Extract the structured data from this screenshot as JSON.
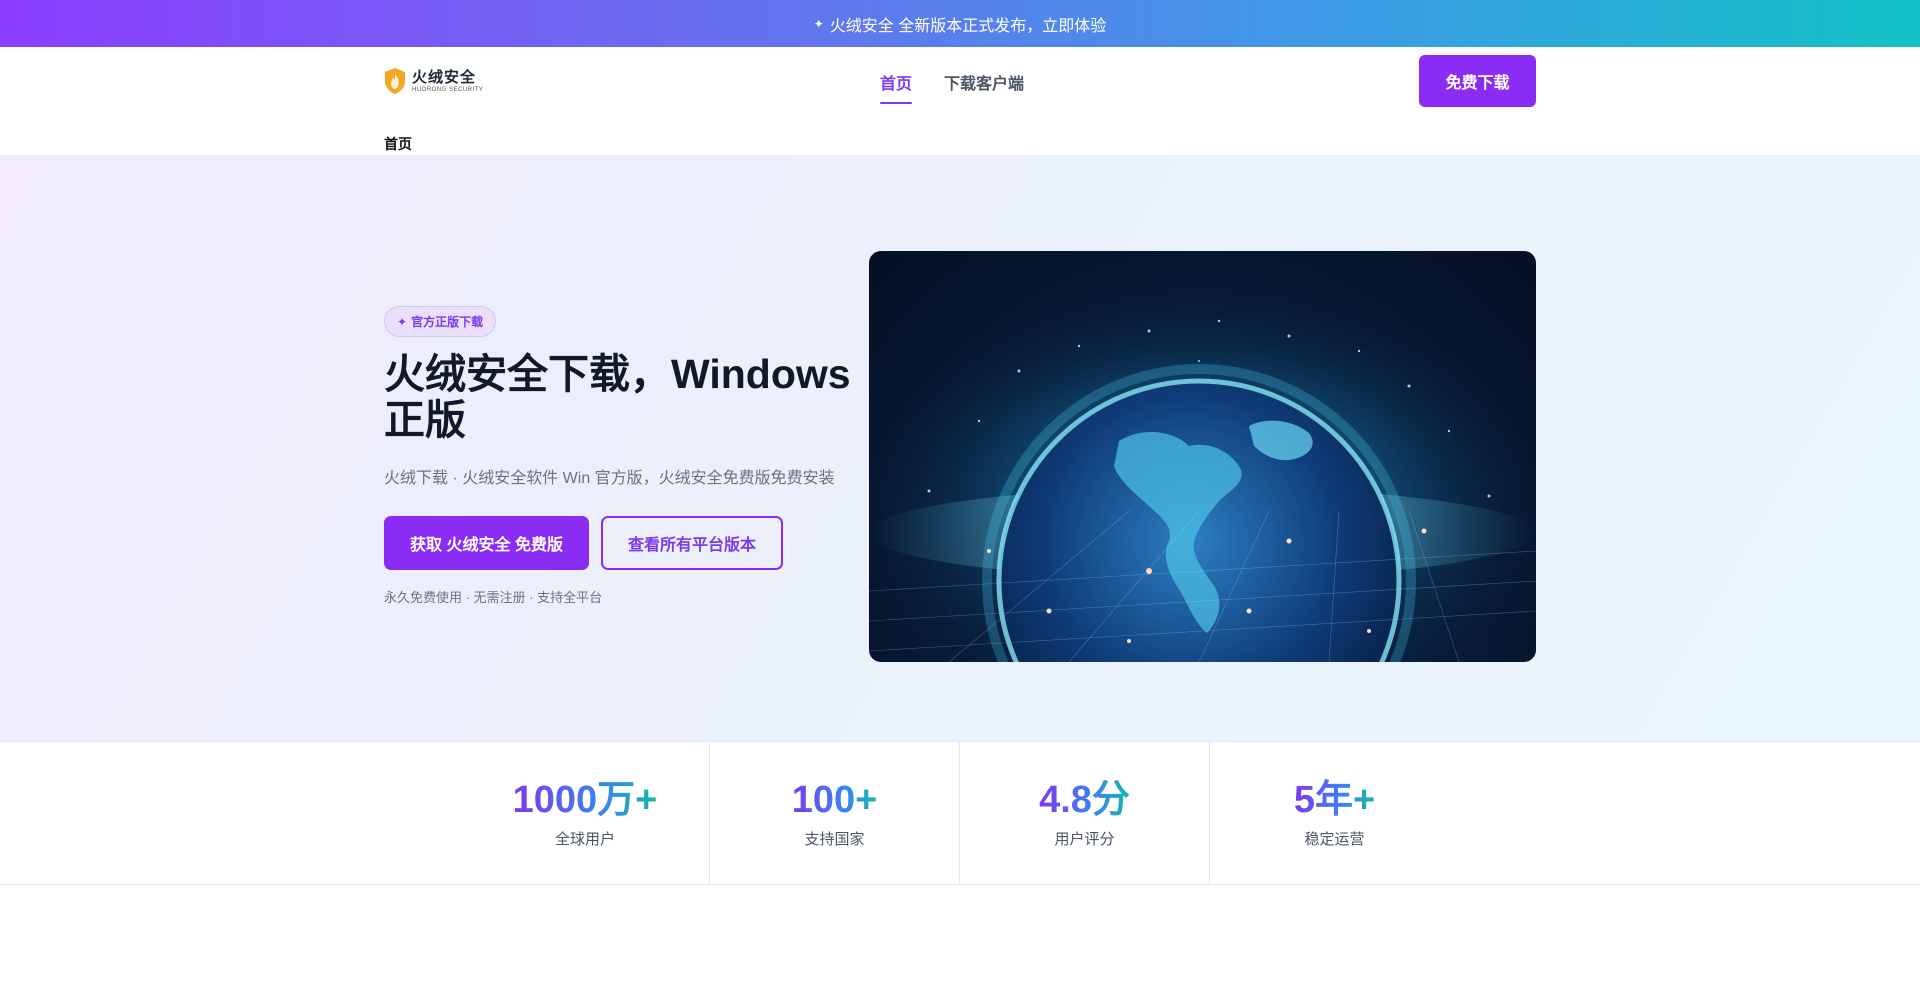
{
  "announcement": {
    "text": "火绒安全 全新版本正式发布，立即体验"
  },
  "header": {
    "logo_text": "火绒安全",
    "logo_subtext": "HUORONG SECURITY",
    "nav": [
      {
        "label": "首页",
        "active": true
      },
      {
        "label": "下载客户端",
        "active": false
      }
    ],
    "cta_label": "免费下载"
  },
  "breadcrumb": {
    "current": "首页"
  },
  "hero": {
    "badge": "官方正版下载",
    "title": "火绒安全下载，Windows 正版",
    "subtitle": "火绒下载 · 火绒安全软件 Win 官方版，火绒安全免费版免费安装",
    "primary_button": "获取 火绒安全 免费版",
    "secondary_button": "查看所有平台版本",
    "note": "永久免费使用 · 无需注册 · 支持全平台"
  },
  "stats": [
    {
      "value": "1000万+",
      "label": "全球用户"
    },
    {
      "value": "100+",
      "label": "支持国家"
    },
    {
      "value": "4.8分",
      "label": "用户评分"
    },
    {
      "value": "5年+",
      "label": "稳定运营"
    }
  ],
  "colors": {
    "brand": "#8b2cf5",
    "accent_text": "#7c3aed"
  }
}
